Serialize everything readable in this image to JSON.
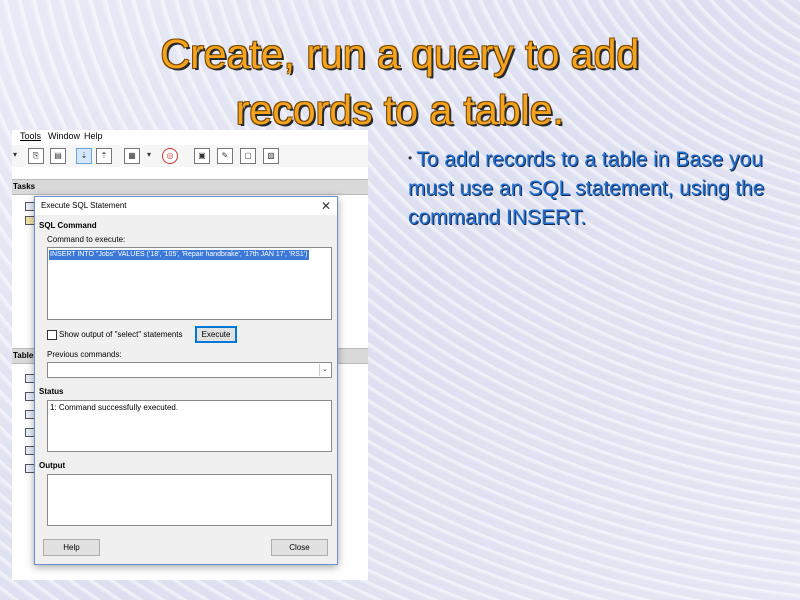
{
  "slide": {
    "title_line1": "Create, run a query to add",
    "title_line2": "records to a table.",
    "bullet": "To add records to a table in Base you must use an SQL statement, using the command INSERT."
  },
  "menubar": {
    "items": [
      "Tools",
      "Window",
      "Help"
    ]
  },
  "panels": {
    "tasks": "Tasks",
    "tables": "Tables"
  },
  "dialog": {
    "title": "Execute SQL Statement",
    "close_glyph": "✕",
    "section_sql": "SQL Command",
    "command_label": "Command to execute:",
    "command_value": "INSERT INTO \"Jobs\" VALUES ('18', '105', 'Repair handbrake', '17th JAN 17', 'RS1')",
    "show_output_label": "Show output of \"select\" statements",
    "show_output_checked": false,
    "execute_button": "Execute",
    "previous_label": "Previous commands:",
    "previous_value": "",
    "status_label": "Status",
    "status_text": "1: Command successfully executed.",
    "output_label": "Output",
    "output_text": "",
    "help_button": "Help",
    "close_button": "Close"
  },
  "colors": {
    "title": "#f5a21d",
    "bullet": "#1f6fd1",
    "selection": "#3c78d8"
  }
}
